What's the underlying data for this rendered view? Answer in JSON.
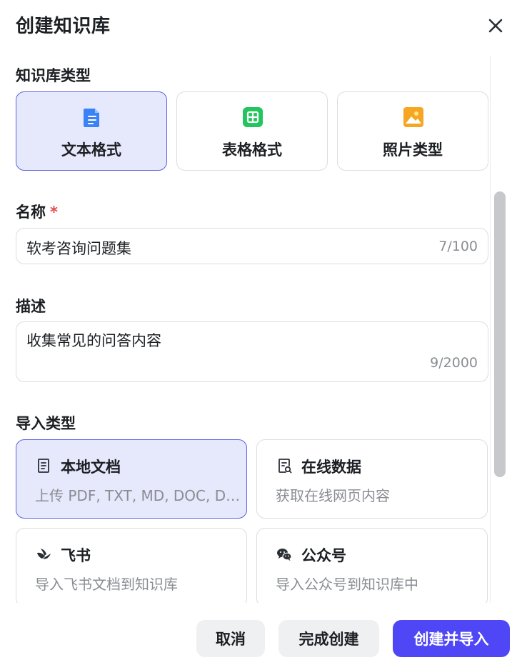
{
  "dialog": {
    "title": "创建知识库",
    "close_icon": "close-icon"
  },
  "kb_type": {
    "label": "知识库类型",
    "options": [
      {
        "label": "文本格式",
        "icon": "text-document-icon",
        "color": "#3b82f6",
        "selected": true
      },
      {
        "label": "表格格式",
        "icon": "table-icon",
        "color": "#22c55e",
        "selected": false
      },
      {
        "label": "照片类型",
        "icon": "photo-icon",
        "color": "#f5a623",
        "selected": false
      }
    ]
  },
  "name_field": {
    "label": "名称",
    "required_mark": "*",
    "value": "软考咨询问题集",
    "count": "7/100"
  },
  "description_field": {
    "label": "描述",
    "value": "收集常见的问答内容",
    "count": "9/2000"
  },
  "import_type": {
    "label": "导入类型",
    "options": [
      {
        "title": "本地文档",
        "desc": "上传 PDF, TXT, MD, DOC, DOCX 格式的本地文件",
        "icon": "document-icon",
        "selected": true
      },
      {
        "title": "在线数据",
        "desc": "获取在线网页内容",
        "icon": "web-document-icon",
        "selected": false
      },
      {
        "title": "飞书",
        "desc": "导入飞书文档到知识库",
        "icon": "feishu-icon",
        "selected": false
      },
      {
        "title": "公众号",
        "desc": "导入公众号到知识库中",
        "icon": "wechat-icon",
        "selected": false
      }
    ]
  },
  "footer": {
    "cancel_label": "取消",
    "finish_label": "完成创建",
    "create_import_label": "创建并导入"
  },
  "colors": {
    "primary": "#4f46f5",
    "selected_bg": "#e6e8fb",
    "selected_border": "#5b63e0",
    "required": "#e5484d"
  }
}
